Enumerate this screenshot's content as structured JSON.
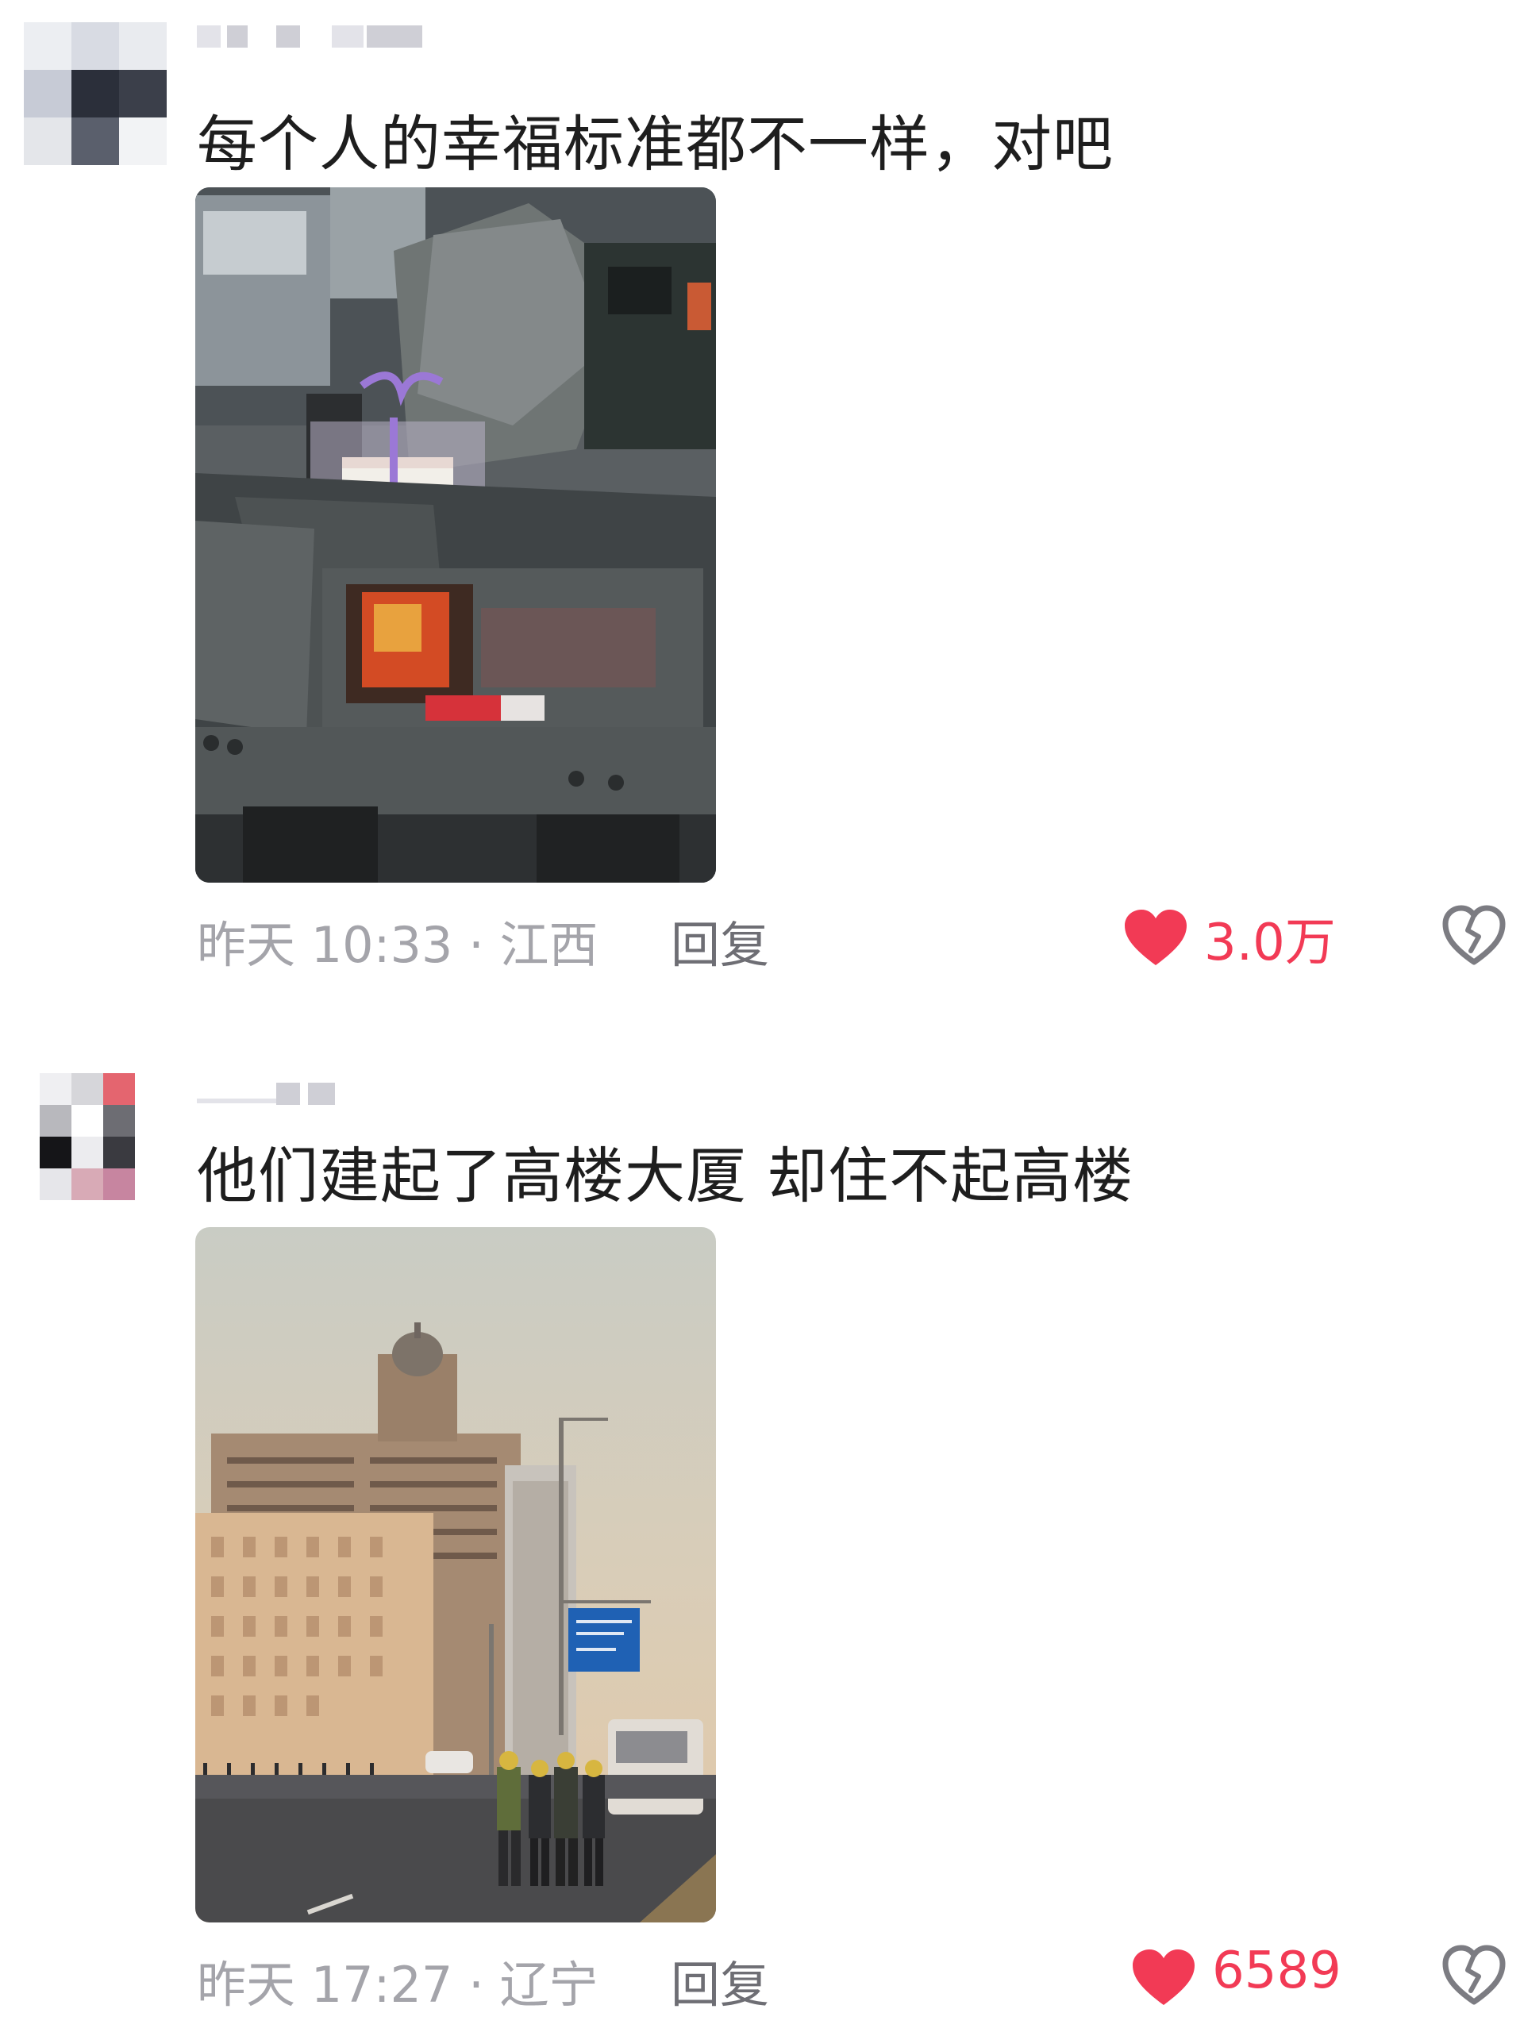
{
  "comments": [
    {
      "text": "每个人的幸福标准都不一样，对吧",
      "timestamp": "昨天 10:33 · 江西",
      "reply_label": "回复",
      "like_count": "3.0万",
      "like_icon": "heart-icon",
      "dislike_icon": "broken-heart-icon"
    },
    {
      "text": "他们建起了高楼大厦 却住不起高楼",
      "timestamp": "昨天 17:27 · 辽宁",
      "reply_label": "回复",
      "like_count": "6589",
      "like_icon": "heart-icon",
      "dislike_icon": "broken-heart-icon"
    }
  ],
  "colors": {
    "accent": "#f23a55",
    "meta": "#a4a4aa",
    "text": "#1e1e1e"
  }
}
